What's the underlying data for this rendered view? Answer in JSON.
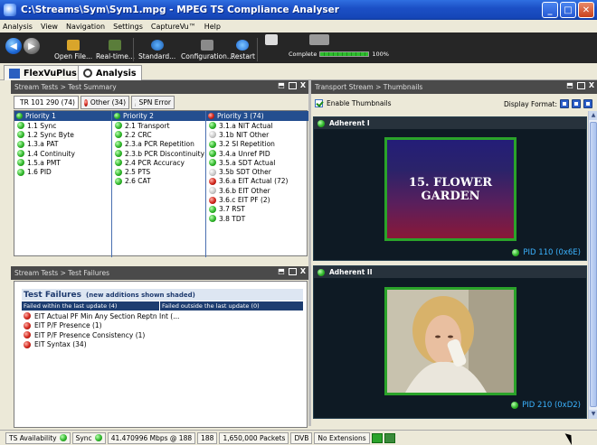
{
  "window": {
    "title": "C:\\Streams\\Sym\\Sym1.mpg - MPEG TS Compliance Analyser",
    "controls": [
      "minimize",
      "maximize",
      "close"
    ]
  },
  "menu": [
    "Analysis",
    "View",
    "Navigation",
    "Settings",
    "CaptureVu™",
    "Help"
  ],
  "toolbar": {
    "open_file": "Open File...",
    "realtime": "Real-time...",
    "standard": "Standard...",
    "configuration": "Configuration...",
    "restart": "Restart",
    "complete_label": "Complete",
    "complete_percent": "100%",
    "complete_fraction": 1.0
  },
  "workspace_tabs": [
    "FlexVuPlus™",
    "Analysis"
  ],
  "test_summary": {
    "title": "Stream Tests > Test Summary",
    "tabs": [
      "TR 101 290 (74)",
      "Other (34)",
      "SPN Error"
    ],
    "columns": [
      {
        "header": "Priority 1",
        "status": "green",
        "items": [
          {
            "label": "1.1 Sync",
            "status": "green"
          },
          {
            "label": "1.2 Sync Byte",
            "status": "green"
          },
          {
            "label": "1.3.a PAT",
            "status": "green"
          },
          {
            "label": "1.4 Continuity",
            "status": "green"
          },
          {
            "label": "1.5.a PMT",
            "status": "green"
          },
          {
            "label": "1.6 PID",
            "status": "green"
          }
        ]
      },
      {
        "header": "Priority 2",
        "status": "green",
        "items": [
          {
            "label": "2.1 Transport",
            "status": "green"
          },
          {
            "label": "2.2 CRC",
            "status": "green"
          },
          {
            "label": "2.3.a PCR Repetition",
            "status": "green"
          },
          {
            "label": "2.3.b PCR Discontinuity I...",
            "status": "green"
          },
          {
            "label": "2.4 PCR Accuracy",
            "status": "green"
          },
          {
            "label": "2.5 PTS",
            "status": "green"
          },
          {
            "label": "2.6 CAT",
            "status": "green"
          }
        ]
      },
      {
        "header": "Priority 3 (74)",
        "status": "red",
        "items": [
          {
            "label": "3.1.a NIT Actual",
            "status": "green"
          },
          {
            "label": "3.1b NIT Other",
            "status": "gray"
          },
          {
            "label": "3.2 SI Repetition",
            "status": "green"
          },
          {
            "label": "3.4.a Unref PID",
            "status": "green"
          },
          {
            "label": "3.5.a SDT Actual",
            "status": "green"
          },
          {
            "label": "3.5b SDT Other",
            "status": "gray"
          },
          {
            "label": "3.6.a EIT Actual (72)",
            "status": "red"
          },
          {
            "label": "3.6.b EIT Other",
            "status": "gray"
          },
          {
            "label": "3.6.c EIT PF (2)",
            "status": "red"
          },
          {
            "label": "3.7 RST",
            "status": "green"
          },
          {
            "label": "3.8 TDT",
            "status": "green"
          }
        ]
      }
    ]
  },
  "test_failures": {
    "title": "Stream Tests > Test Failures",
    "heading": "Test Failures",
    "note": "(new additions shown shaded)",
    "failed_within": "Failed within the last update (4)",
    "failed_outside": "Failed outside the last update (0)",
    "items": [
      "EIT Actual PF Min Any Section Reptn Int (...",
      "EIT P/F Presence (1)",
      "EIT P/F Presence Consistency (1)",
      "EIT Syntax (34)"
    ]
  },
  "thumbnails": {
    "title": "Transport Stream > Thumbnails",
    "enable_label": "Enable Thumbnails",
    "display_format_label": "Display Format:",
    "items": [
      {
        "name": "Adherent I",
        "pid": "PID 110 (0x6E)",
        "caption_line1": "15. FLOWER",
        "caption_line2": "GARDEN"
      },
      {
        "name": "Adherent II",
        "pid": "PID 210 (0xD2)"
      }
    ]
  },
  "statusbar": {
    "ts_availability": "TS Availability",
    "sync": "Sync",
    "bitrate": "41.470996 Mbps @ 188",
    "packet_size": "188",
    "packets": "1,650,000 Packets",
    "dvb": "DVB",
    "extensions": "No Extensions"
  }
}
